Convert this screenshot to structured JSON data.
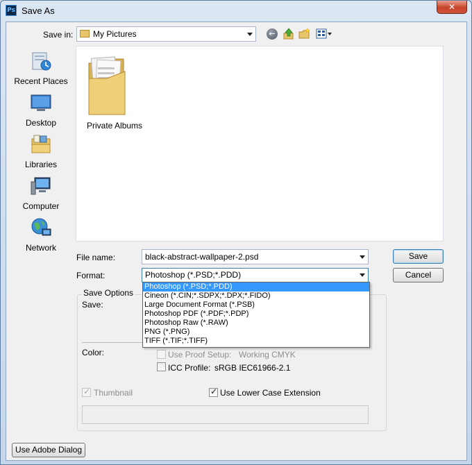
{
  "window": {
    "app_icon_text": "Ps",
    "title": "Save As",
    "close_glyph": "✕"
  },
  "toolbar": {
    "save_in_label": "Save in:",
    "save_in_value": "My Pictures",
    "back_icon": "back-arrow-icon",
    "up_icon": "up-folder-icon",
    "new_folder_icon": "new-folder-icon",
    "views_icon": "views-menu-icon"
  },
  "places": [
    {
      "label": "Recent Places",
      "icon": "recent-places-icon"
    },
    {
      "label": "Desktop",
      "icon": "desktop-icon"
    },
    {
      "label": "Libraries",
      "icon": "libraries-icon"
    },
    {
      "label": "Computer",
      "icon": "computer-icon"
    },
    {
      "label": "Network",
      "icon": "network-icon"
    }
  ],
  "files": [
    {
      "name": "Private Albums",
      "icon": "folder-icon"
    }
  ],
  "form": {
    "file_name_label": "File name:",
    "file_name_value": "black-abstract-wallpaper-2.psd",
    "format_label": "Format:",
    "format_value": "Photoshop (*.PSD;*.PDD)",
    "format_options": [
      "Photoshop (*.PSD;*.PDD)",
      "Cineon (*.CIN;*.SDPX;*.DPX;*.FIDO)",
      "Large Document Format (*.PSB)",
      "Photoshop PDF (*.PDF;*.PDP)",
      "Photoshop Raw (*.RAW)",
      "PNG (*.PNG)",
      "TIFF (*.TIF;*.TIFF)"
    ],
    "format_selected_index": 0
  },
  "buttons": {
    "save": "Save",
    "cancel": "Cancel",
    "use_adobe_dialog": "Use Adobe Dialog"
  },
  "save_options": {
    "title": "Save Options",
    "save_label": "Save:",
    "color_label": "Color:",
    "use_proof_setup": {
      "label": "Use Proof Setup:",
      "value": "Working CMYK",
      "checked": false,
      "enabled": false
    },
    "icc_profile": {
      "label": "ICC Profile:",
      "value": "sRGB IEC61966-2.1",
      "checked": false,
      "enabled": true
    },
    "thumbnail": {
      "label": "Thumbnail",
      "checked": true,
      "enabled": false
    },
    "lower_case_extension": {
      "label": "Use Lower Case Extension",
      "checked": true,
      "enabled": true
    }
  },
  "colors": {
    "selection_blue": "#3399ff",
    "close_red": "#c7432b",
    "folder_yellow": "#e8c46a"
  }
}
